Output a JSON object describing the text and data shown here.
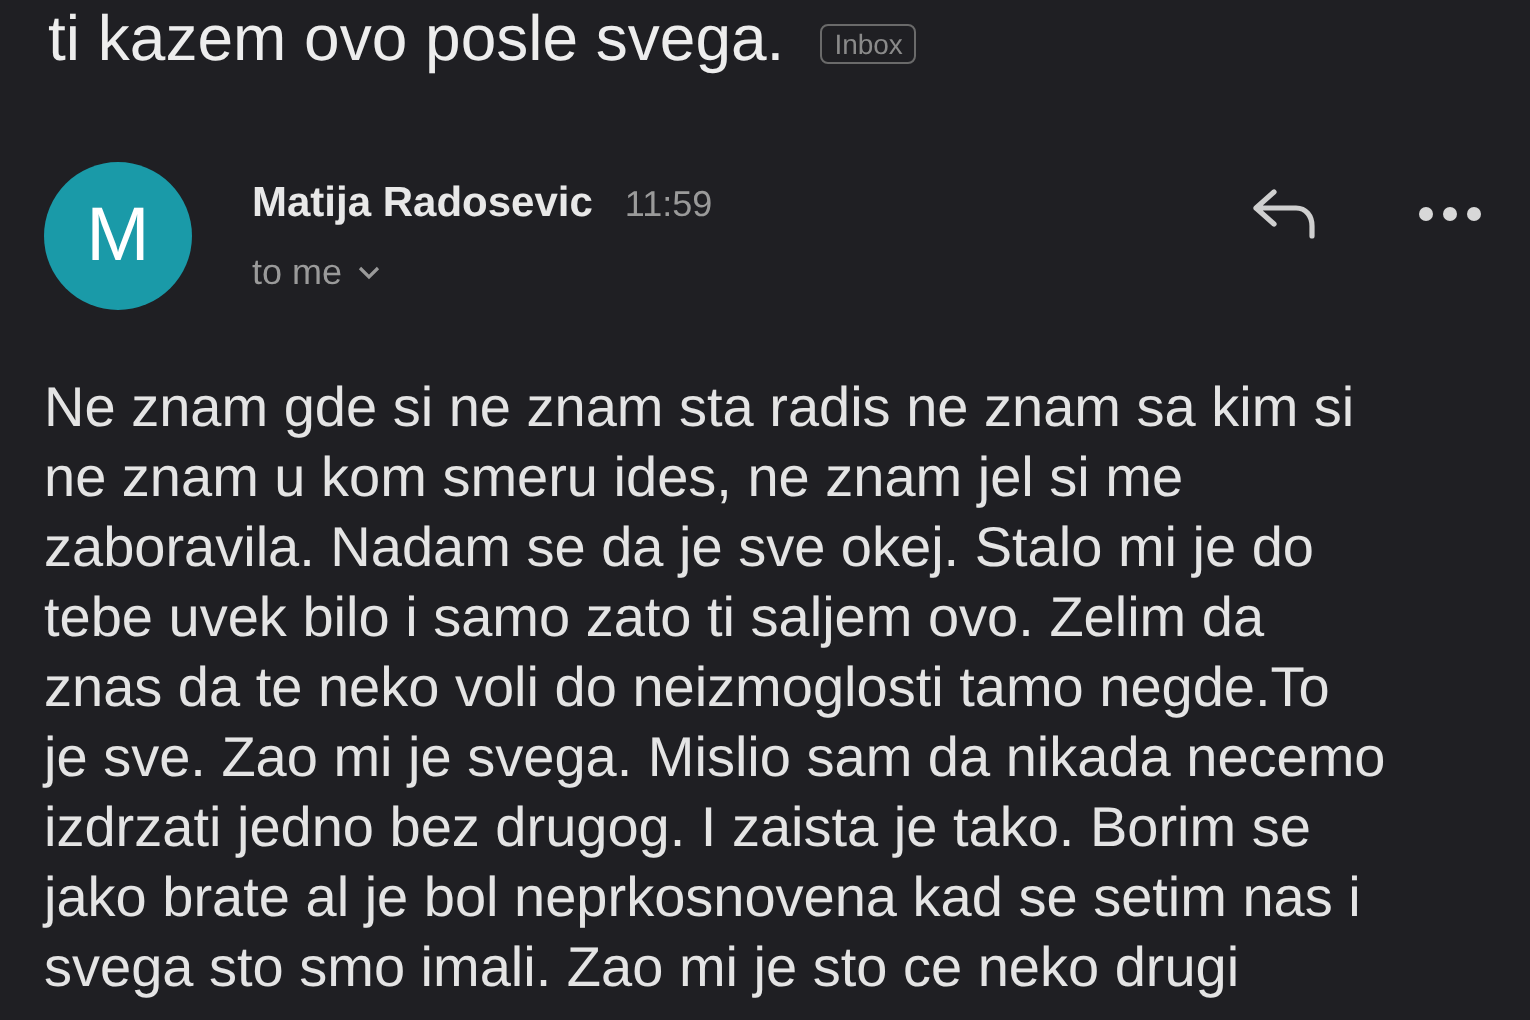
{
  "subject": {
    "text": "ti kazem ovo posle svega.",
    "label": "Inbox"
  },
  "message": {
    "avatar_letter": "M",
    "sender": "Matija Radosevic",
    "time": "11:59",
    "recipient": "to me"
  },
  "body": {
    "lines": [
      "Ne znam gde si ne znam sta radis ne znam sa kim si",
      "ne znam u kom smeru ides, ne znam jel si me",
      "zaboravila. Nadam se da je sve okej. Stalo mi je do",
      "tebe uvek bilo i samo zato ti saljem ovo. Zelim da",
      "znas da te neko voli do neizmoglosti tamo negde.To",
      "je sve. Zao mi je svega. Mislio sam da nikada necemo",
      "izdrzati jedno bez drugog. I zaista je tako. Borim se",
      "jako brate al je bol neprkosnovena kad se setim nas i",
      "svega sto smo imali. Zao mi je sto ce neko drugi"
    ]
  }
}
